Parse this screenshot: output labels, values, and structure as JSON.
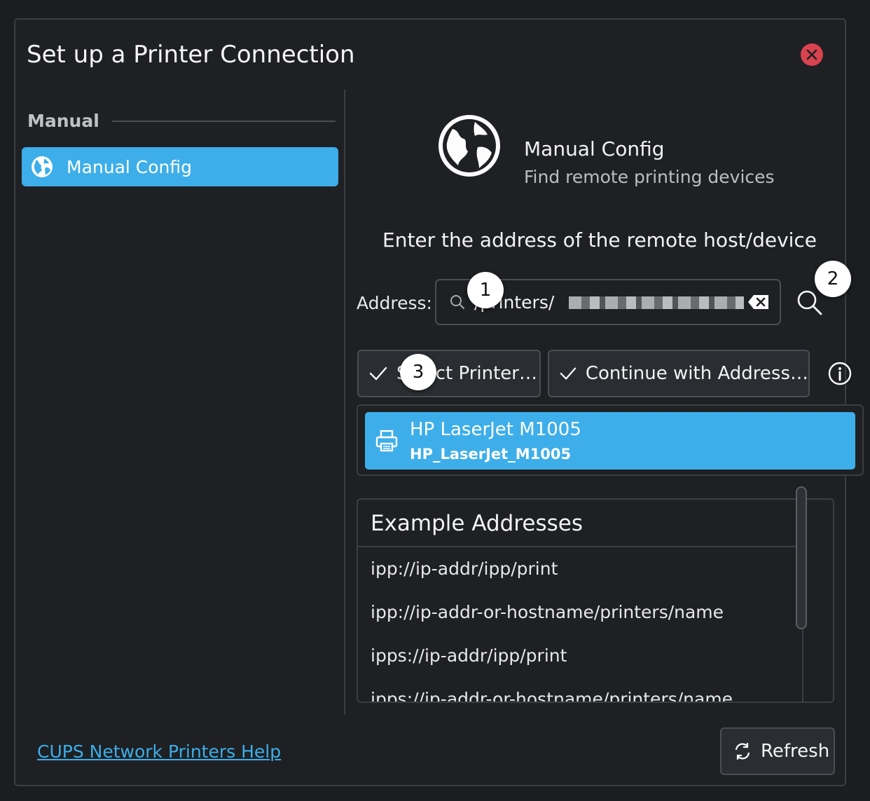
{
  "window": {
    "title": "Set up a Printer Connection"
  },
  "sidebar": {
    "section_label": "Manual",
    "items": [
      {
        "label": "Manual Config",
        "icon": "globe-icon",
        "selected": true
      }
    ]
  },
  "main": {
    "header_title": "Manual Config",
    "header_subtitle": "Find remote printing devices",
    "prompt": "Enter the address of the remote host/device",
    "address_label": "Address:",
    "address_value": "/printers/",
    "select_printer_label": "Select Printer…",
    "continue_label": "Continue with Address…",
    "printers": [
      {
        "name": "HP LaserJet M1005",
        "id": "HP_LaserJet_M1005"
      }
    ],
    "examples_title": "Example Addresses",
    "examples": [
      "ipp://ip-addr/ipp/print",
      "ipp://ip-addr-or-hostname/printers/name",
      "ipps://ip-addr/ipp/print",
      "ipps://ip-addr-or-hostname/printers/name"
    ]
  },
  "footer": {
    "help_link": "CUPS Network Printers Help",
    "refresh_label": "Refresh"
  },
  "markers": [
    "1",
    "2",
    "3"
  ],
  "colors": {
    "accent": "#3daee9",
    "close": "#d9424f",
    "background": "#1e2023"
  }
}
